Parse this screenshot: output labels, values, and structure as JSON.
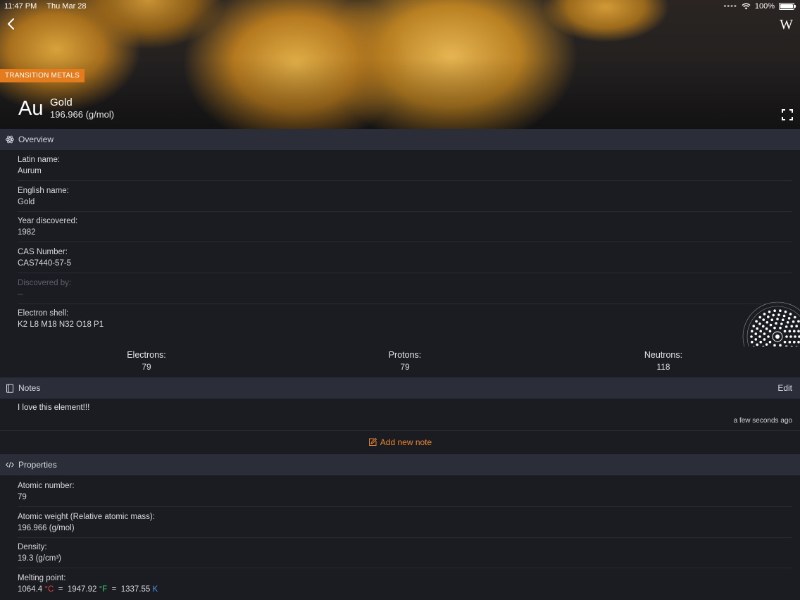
{
  "status_bar": {
    "time": "11:47 PM",
    "date": "Thu Mar 28",
    "battery": "100%"
  },
  "hero": {
    "category_badge": "TRANSITION METALS",
    "symbol": "Au",
    "name": "Gold",
    "weight": "196.966 (g/mol)",
    "wiki_label": "W"
  },
  "overview": {
    "title": "Overview",
    "fields": [
      {
        "label": "Latin name:",
        "value": "Aurum"
      },
      {
        "label": "English name:",
        "value": "Gold"
      },
      {
        "label": "Year discovered:",
        "value": "1982"
      },
      {
        "label": "CAS Number:",
        "value": "CAS7440-57-5"
      },
      {
        "label": "Discovered by:",
        "value": "--"
      },
      {
        "label": "Electron shell:",
        "value": "K2 L8 M18 N32 O18 P1"
      }
    ],
    "counts": [
      {
        "label": "Electrons:",
        "value": "79"
      },
      {
        "label": "Protons:",
        "value": "79"
      },
      {
        "label": "Neutrons:",
        "value": "118"
      }
    ]
  },
  "notes": {
    "title": "Notes",
    "edit_label": "Edit",
    "items": [
      {
        "text": "I love this element!!!",
        "time": "a few seconds ago"
      }
    ],
    "add_label": "Add new note"
  },
  "properties": {
    "title": "Properties",
    "fields": [
      {
        "label": "Atomic number:",
        "value": "79"
      },
      {
        "label": "Atomic weight (Relative atomic mass):",
        "value": "196.966 (g/mol)"
      },
      {
        "label": "Density:",
        "value": "19.3 (g/cm³)"
      }
    ],
    "melting_point": {
      "label": "Melting point:",
      "celsius": "1064.4",
      "celsius_unit": "°C",
      "fahrenheit": "1947.92",
      "fahrenheit_unit": "°F",
      "kelvin": "1337.55",
      "kelvin_unit": "K",
      "eq": "="
    }
  },
  "colors": {
    "accent": "#e47c1d",
    "background": "#1b1c22",
    "section_header": "#2b2e38",
    "celsius": "#e0453d",
    "fahrenheit": "#3ec46d",
    "kelvin": "#4b93e0"
  },
  "icons": [
    "chevron-left-icon",
    "wikipedia-icon",
    "fullscreen-icon",
    "atom-icon",
    "notebook-icon",
    "edit-note-icon",
    "code-icon",
    "wifi-icon",
    "battery-icon"
  ]
}
